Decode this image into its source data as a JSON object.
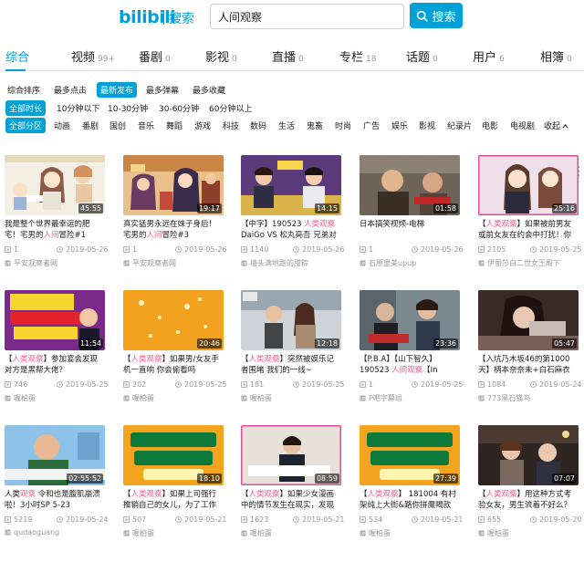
{
  "header": {
    "logo": "bilibili",
    "logo_sub": "搜索",
    "query": "人间观察",
    "search_label": "搜索",
    "brand_color": "#00a1d6"
  },
  "tabs": [
    {
      "label": "综合",
      "count": ""
    },
    {
      "label": "视频",
      "count": "99+"
    },
    {
      "label": "番剧",
      "count": "0"
    },
    {
      "label": "影视",
      "count": "0"
    },
    {
      "label": "直播",
      "count": "0"
    },
    {
      "label": "专栏",
      "count": "18"
    },
    {
      "label": "话题",
      "count": "0"
    },
    {
      "label": "用户",
      "count": "6"
    },
    {
      "label": "相簿",
      "count": "0"
    }
  ],
  "sort_options": [
    "综合排序",
    "最多点击",
    "最新发布",
    "最多弹幕",
    "最多收藏"
  ],
  "duration_options": [
    "全部时长",
    "10分钟以下",
    "10-30分钟",
    "30-60分钟",
    "60分钟以上"
  ],
  "zone_options": [
    "全部分区",
    "动画",
    "番剧",
    "国创",
    "音乐",
    "舞蹈",
    "游戏",
    "科技",
    "数码",
    "生活",
    "鬼畜",
    "时尚",
    "广告",
    "娱乐",
    "影视",
    "纪录片",
    "电影",
    "电视剧"
  ],
  "zone_fold": "收起",
  "videos": [
    {
      "title_pre": "我是整个世界最幸运的肥宅！宅男的",
      "title_hl": "人间",
      "title_post": "冒险#1",
      "duration": "45:55",
      "views": "1",
      "date": "2019-05-26",
      "uploader": "平安观察者网"
    },
    {
      "title_pre": "真实猛男永远在妹子身后！宅男的",
      "title_hl": "人间",
      "title_post": "冒险#3",
      "duration": "19:17",
      "views": "1",
      "date": "2019-05-26",
      "uploader": "平安观察者网"
    },
    {
      "title_pre": "【中字】190523 ",
      "title_hl": "人类观察",
      "title_post": " DaiGo VS 松丸亮吾 兄弟对",
      "duration": "14:15",
      "views": "1140",
      "date": "2019-05-26",
      "uploader": "墙头满地跑的甜粽"
    },
    {
      "title_pre": "日本搞笑视频-电梯",
      "title_hl": "",
      "title_post": "",
      "duration": "01:58",
      "views": "1",
      "date": "2019-05-26",
      "uploader": "石原里美upup"
    },
    {
      "title_pre": "【",
      "title_hl": "人类观察",
      "title_post": "】如果被前男友或前女友在约会中打扰！你会怎么",
      "duration": "25:16",
      "views": "2105",
      "date": "2019-05-25",
      "uploader": "伊丽莎白二世女王殿下"
    },
    {
      "title_pre": "【",
      "title_hl": "人类观察",
      "title_post": "】参加宴会发现对方是黑帮大佬？",
      "duration": "11:54",
      "views": "746",
      "date": "2019-05-25",
      "uploader": "喔柏蛋"
    },
    {
      "title_pre": "【",
      "title_hl": "人类观察",
      "title_post": "】如果男/女友手机一直响 你会偷看吗",
      "duration": "20:46",
      "views": "202",
      "date": "2019-05-25",
      "uploader": "喔柏蛋"
    },
    {
      "title_pre": "【",
      "title_hl": "人类观察",
      "title_post": "】突然被娱乐记者围堵 我们的一线~",
      "duration": "12:18",
      "views": "181",
      "date": "2019-05-25",
      "uploader": "喔柏蛋"
    },
    {
      "title_pre": "【P.B.A】【山下智久】190523 ",
      "title_hl": "人间观察",
      "title_post": "【In",
      "duration": "23:36",
      "views": "1",
      "date": "2019-05-25",
      "uploader": "P吧字幕组"
    },
    {
      "title_pre": "【入坑乃木坂46的第1000天】柄本奈奈未+白石麻衣",
      "title_hl": "",
      "title_post": "",
      "duration": "05:47",
      "views": "1084",
      "date": "2019-05-24",
      "uploader": "773黑石猫鸟"
    },
    {
      "title_pre": "人类",
      "title_hl": "观察",
      "title_post": " 令和也是腹肌崩溃啦！3小时SP 5-23",
      "duration": "02:55:52",
      "views": "5219",
      "date": "2019-05-24",
      "uploader": "qudaoguang"
    },
    {
      "title_pre": "【",
      "title_hl": "人类观察",
      "title_post": "】如果上司强行推销自己的女儿，为了工作",
      "duration": "18:10",
      "views": "507",
      "date": "2019-05-21",
      "uploader": "喔柏蛋"
    },
    {
      "title_pre": "【",
      "title_hl": "人类观察",
      "title_post": "】如果少女漫画中的情节发生在现实，发现",
      "duration": "08:59",
      "views": "1623",
      "date": "2019-05-21",
      "uploader": "喔柏蛋"
    },
    {
      "title_pre": "【",
      "title_hl": "人类观察",
      "title_post": "】 181004 有村架纯上大街&路你拼魔喝款",
      "duration": "27:39",
      "views": "534",
      "date": "2019-05-21",
      "uploader": "喔柏蛋"
    },
    {
      "title_pre": "【",
      "title_hl": "人类观察",
      "title_post": "】用这种方式考验女友，男生流着不好么？",
      "duration": "07:07",
      "views": "655",
      "date": "2019-05-20",
      "uploader": "喔柏蛋"
    }
  ]
}
